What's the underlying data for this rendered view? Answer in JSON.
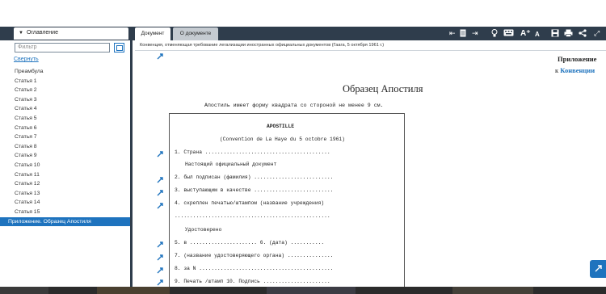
{
  "sidebar": {
    "tab_label": "Оглавление",
    "filter_placeholder": "Фильтр",
    "collapse_label": "Свернуть",
    "items": [
      "Преамбула",
      "Статья 1",
      "Статья 2",
      "Статья 3",
      "Статья 4",
      "Статья 5",
      "Статья 6",
      "Статья 7",
      "Статья 8",
      "Статья 9",
      "Статья 10",
      "Статья 11",
      "Статья 12",
      "Статья 13",
      "Статья 14",
      "Статья 15"
    ],
    "active_item": "Приложение. Образец Апостиля"
  },
  "tabs": {
    "document": "Документ",
    "about": "О документе"
  },
  "toolbar": {
    "font_increase": "A⁺",
    "font_label": "A"
  },
  "breadcrumb": "Конвенция, отменяющая требование легализации иностранных официальных документов (Гаага, 5 октября 1961 г.)",
  "document": {
    "appendix_title": "Приложение",
    "appendix_prefix": "к",
    "appendix_link": "Конвенции",
    "title": "Образец Апостиля",
    "subtitle": "Апостиль имеет форму квадрата со стороной не менее 9 см.",
    "apostille_heading": "APOSTILLE",
    "convention_line": "(Convention de La Haye du 5 octobre 1961)",
    "line1": "1. Страна  .........................................",
    "line1b": "Настоящий официальный документ",
    "line2": "2. был подписан (фамилия) ..........................",
    "line3": "3. выступающим в качестве ..........................",
    "line4": "4. скреплен печатью/штампом (название учреждения)",
    "line4b": "...................................................",
    "certified": "Удостоверено",
    "line5": "5. в ...................... 6. (дата) ...........",
    "line7": "7. (название удостоверяющего органа) ...............",
    "line8": "8. за N ............................................",
    "line9": "9. Печать /штамп  10. Подпись ......................"
  },
  "colors": {
    "nav_dark": "#2f3d4c",
    "accent": "#1e73be"
  }
}
